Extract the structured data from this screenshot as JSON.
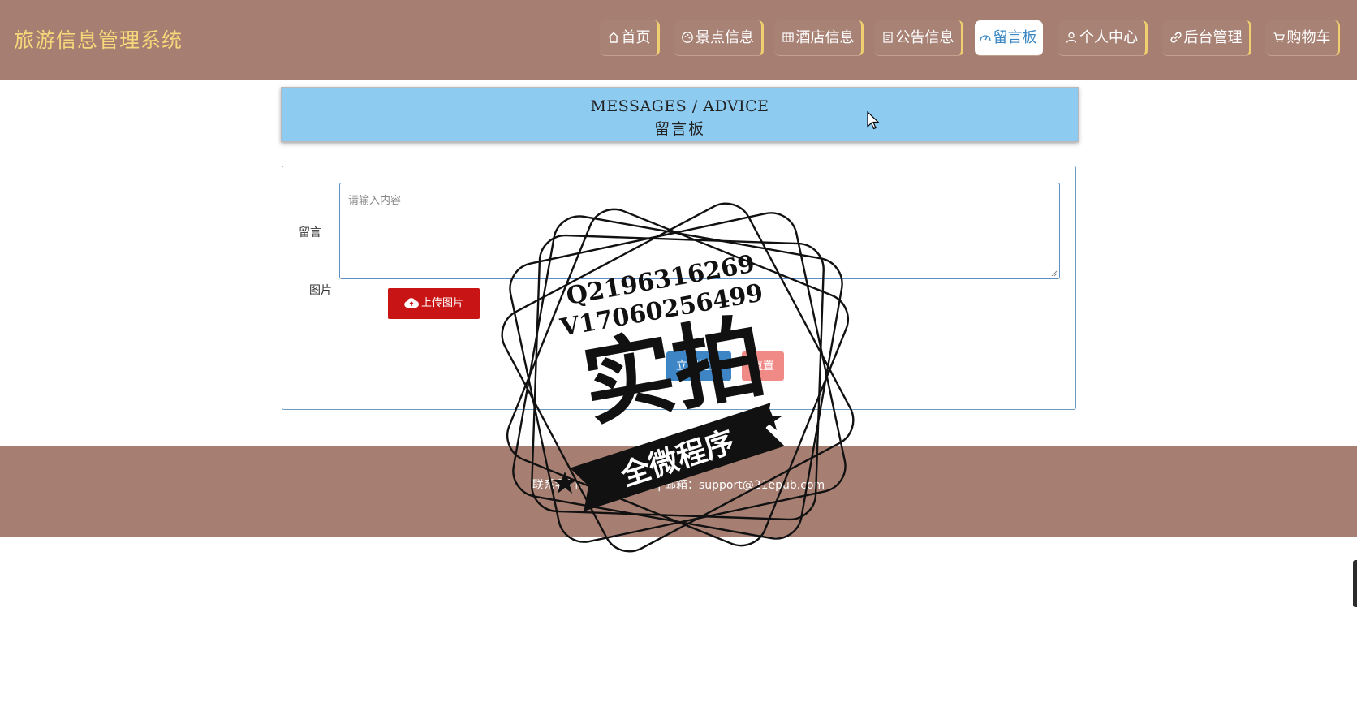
{
  "header": {
    "title": "旅游信息管理系统",
    "nav": [
      {
        "label": "首页",
        "icon": "home-icon"
      },
      {
        "label": "景点信息",
        "icon": "palette-icon"
      },
      {
        "label": "酒店信息",
        "icon": "grid-icon"
      },
      {
        "label": "公告信息",
        "icon": "document-icon"
      },
      {
        "label": "留言板",
        "icon": "dashboard-icon",
        "active": true
      },
      {
        "label": "个人中心",
        "icon": "user-icon"
      },
      {
        "label": "后台管理",
        "icon": "link-icon"
      },
      {
        "label": "购物车",
        "icon": "cart-icon"
      }
    ]
  },
  "banner": {
    "en": "MESSAGES / ADVICE",
    "cn": "留言板"
  },
  "form": {
    "message_label": "留言",
    "message_placeholder": "请输入内容",
    "message_value": "",
    "image_label": "图片",
    "upload_label": "上传图片",
    "submit_label": "立即提交",
    "reset_label": "重置"
  },
  "footer": {
    "contact": "联系我们：13086***** | 邮箱：support@21epub.com"
  },
  "watermark": {
    "line1": "Q2196316269",
    "line2": "V17060256499",
    "main": "实拍",
    "ribbon": "全微程序"
  },
  "colors": {
    "header_bg": "#a67f72",
    "brand": "#f6d77a",
    "nav_accent": "#f0cf6f",
    "active_text": "#3a87c4",
    "banner_bg": "#8ecbf1",
    "upload_bg": "#c81414",
    "submit_bg": "#3e85c6",
    "reset_bg": "#f08a87"
  }
}
